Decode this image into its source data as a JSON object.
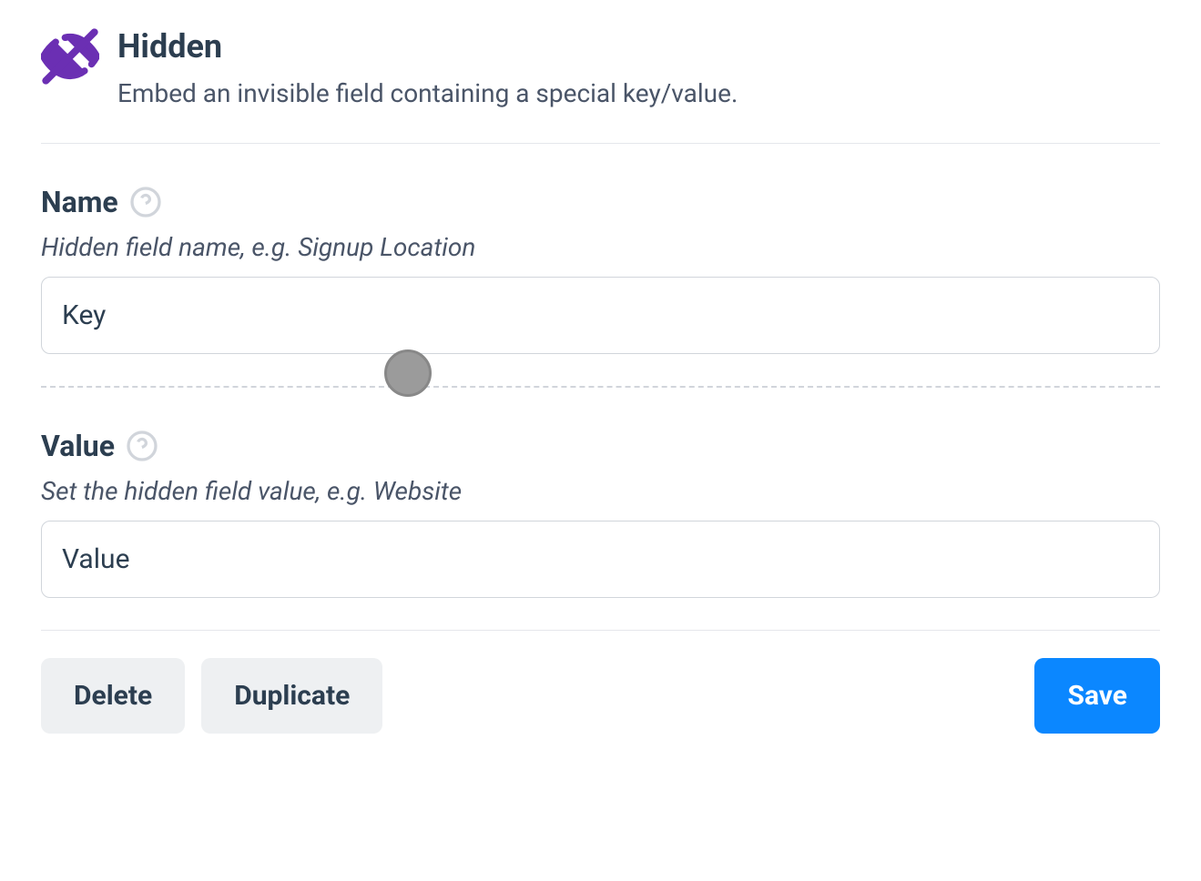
{
  "header": {
    "title": "Hidden",
    "description": "Embed an invisible field containing a special key/value."
  },
  "fields": {
    "name": {
      "label": "Name",
      "hint": "Hidden field name, e.g. Signup Location",
      "value": "Key",
      "placeholder": ""
    },
    "value": {
      "label": "Value",
      "hint": "Set the hidden field value, e.g. Website",
      "value": "Value",
      "placeholder": ""
    }
  },
  "buttons": {
    "delete": "Delete",
    "duplicate": "Duplicate",
    "save": "Save"
  }
}
